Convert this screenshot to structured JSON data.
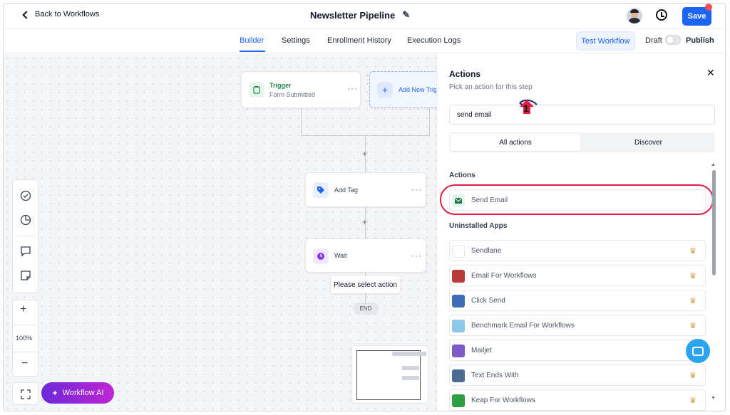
{
  "header": {
    "back_label": "Back to Workflows",
    "title": "Newsletter Pipeline",
    "save_label": "Save"
  },
  "tabs": {
    "items": [
      "Builder",
      "Settings",
      "Enrollment History",
      "Execution Logs"
    ],
    "active": "Builder",
    "test_workflow": "Test Workflow",
    "draft": "Draft",
    "publish": "Publish"
  },
  "canvas": {
    "trigger": {
      "title": "Trigger",
      "subtitle": "Form Submitted"
    },
    "add_trigger": "Add New Trigger",
    "nodes": [
      {
        "label": "Add Tag"
      },
      {
        "label": "Wait"
      }
    ],
    "tooltip": "Please select action",
    "end_label": "END",
    "zoom": "100%",
    "workflow_ai": "Workflow AI"
  },
  "panel": {
    "title": "Actions",
    "subtitle": "Pick an action for this step",
    "search_value": "send email",
    "segments": [
      "All actions",
      "Discover"
    ],
    "section_actions": "Actions",
    "actions": [
      {
        "label": "Send Email"
      }
    ],
    "section_uninstalled": "Uninstalled Apps",
    "apps": [
      {
        "label": "Sendlane",
        "color": "#ffffff"
      },
      {
        "label": "Email For Workflows",
        "color": "#b83b3b"
      },
      {
        "label": "Click Send",
        "color": "#3e6fb6"
      },
      {
        "label": "Benchmark Email For Workflows",
        "color": "#8fc7e8"
      },
      {
        "label": "Mailjet",
        "color": "#7c5cc4"
      },
      {
        "label": "Text Ends With",
        "color": "#4b6b8f"
      },
      {
        "label": "Keap For Workflows",
        "color": "#2f9e44"
      }
    ]
  },
  "annotation": {
    "number": "1"
  },
  "colors": {
    "accent": "#1c64f2",
    "highlight": "#e11d48"
  }
}
